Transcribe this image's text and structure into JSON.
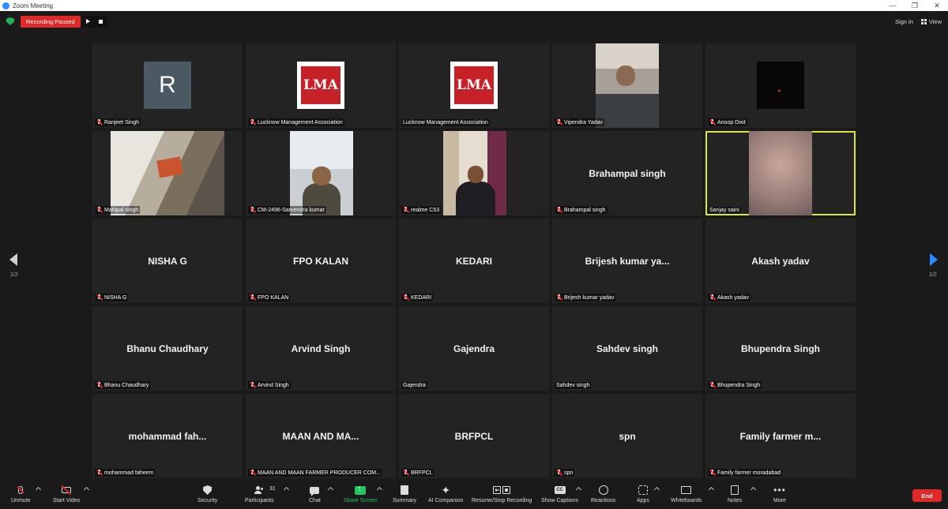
{
  "window": {
    "title": "Zoom Meeting",
    "controls": [
      "—",
      "❐",
      "✕"
    ]
  },
  "topbar": {
    "recording_status": "Recording Paused",
    "sign_in": "Sign in",
    "view": "View"
  },
  "tiles": [
    {
      "bigname": "",
      "label": "Ranjeet Singh",
      "muted": true,
      "media": "avatar-r",
      "avatar_letter": "R"
    },
    {
      "bigname": "",
      "label": "Lucknow Management Association",
      "muted": true,
      "media": "lma",
      "logo_text": "LMA"
    },
    {
      "bigname": "",
      "label": "Lucknow Management Association",
      "muted": false,
      "media": "lma",
      "logo_text": "LMA"
    },
    {
      "bigname": "",
      "label": "Vipendra Yadav",
      "muted": true,
      "media": "video-vipendra"
    },
    {
      "bigname": "",
      "label": "Anoop Dixit",
      "muted": true,
      "media": "video-dark"
    },
    {
      "bigname": "",
      "label": "Mahipal singh",
      "muted": true,
      "media": "video-mahipal"
    },
    {
      "bigname": "",
      "label": "CM-2496-Sarvendra kumar",
      "muted": true,
      "media": "video-sarvendra"
    },
    {
      "bigname": "",
      "label": "realme C53",
      "muted": true,
      "media": "video-realme"
    },
    {
      "bigname": "Brahampal singh",
      "label": "Brahampal singh",
      "muted": true,
      "media": "none"
    },
    {
      "bigname": "",
      "label": "Sanjay saini",
      "muted": false,
      "media": "video-sanjay",
      "active_speaker": true
    },
    {
      "bigname": "NISHA G",
      "label": "NISHA G",
      "muted": true,
      "media": "none"
    },
    {
      "bigname": "FPO KALAN",
      "label": "FPO KALAN",
      "muted": true,
      "media": "none"
    },
    {
      "bigname": "KEDARI",
      "label": "KEDARI",
      "muted": true,
      "media": "none"
    },
    {
      "bigname": "Brijesh kumar ya...",
      "label": "Brijesh kumar yadav",
      "muted": true,
      "media": "none"
    },
    {
      "bigname": "Akash yadav",
      "label": "Akash yadav",
      "muted": true,
      "media": "none"
    },
    {
      "bigname": "Bhanu Chaudhary",
      "label": "Bhanu Chaudhary",
      "muted": true,
      "media": "none"
    },
    {
      "bigname": "Arvind Singh",
      "label": "Arvind Singh",
      "muted": true,
      "media": "none"
    },
    {
      "bigname": "Gajendra",
      "label": "Gajendra",
      "muted": false,
      "media": "none"
    },
    {
      "bigname": "Sahdev singh",
      "label": "Sahdev singh",
      "muted": false,
      "media": "none"
    },
    {
      "bigname": "Bhupendra Singh",
      "label": "Bhupendra Singh",
      "muted": true,
      "media": "none"
    },
    {
      "bigname": "mohammad  fah...",
      "label": "mohammad faheem",
      "muted": true,
      "media": "none"
    },
    {
      "bigname": "MAAN  AND  MA...",
      "label": "MAAN AND MAAN FARMER PRODUCER COM...",
      "muted": true,
      "media": "none"
    },
    {
      "bigname": "BRFPCL",
      "label": "BRFPCL",
      "muted": true,
      "media": "none"
    },
    {
      "bigname": "spn",
      "label": "spn",
      "muted": true,
      "media": "none"
    },
    {
      "bigname": "Family  farmer  m...",
      "label": "Family farmer moradabad",
      "muted": true,
      "media": "none"
    }
  ],
  "pagination": {
    "left": "1/2",
    "right": "1/2"
  },
  "toolbar": {
    "unmute": "Unmute",
    "start_video": "Start Video",
    "security": "Security",
    "participants": "Participants",
    "participants_count": "31",
    "chat": "Chat",
    "share_screen": "Share Screen",
    "summary": "Summary",
    "ai_companion": "AI Companion",
    "resume_stop_recording": "Resume/Stop Recording",
    "show_captions": "Show Captions",
    "reactions": "Reactions",
    "apps": "Apps",
    "whiteboards": "Whiteboards",
    "notes": "Notes",
    "more": "More",
    "end": "End"
  },
  "colors": {
    "accent": "#2d8cff",
    "recording": "#e02828",
    "active_speaker": "#d9e43b",
    "share": "#22c55e"
  }
}
